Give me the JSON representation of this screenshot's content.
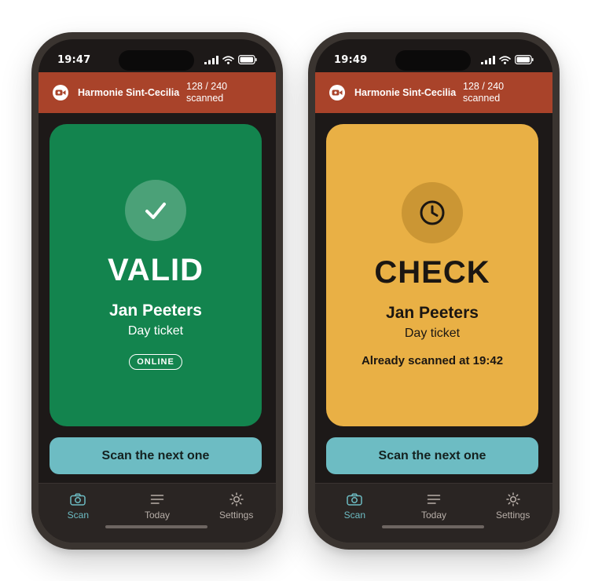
{
  "phones": [
    {
      "status_time": "19:47",
      "header": {
        "org_name": "Harmonie Sint-Cecilia",
        "count": "128 / 240",
        "count_label": "scanned"
      },
      "result": {
        "status": "VALID",
        "icon": "checkmark-icon",
        "color": "#13844e",
        "holder_name": "Jan Peeters",
        "ticket_type": "Day ticket",
        "badge": "ONLINE"
      },
      "next_button": "Scan the next one"
    },
    {
      "status_time": "19:49",
      "header": {
        "org_name": "Harmonie Sint-Cecilia",
        "count": "128 / 240",
        "count_label": "scanned"
      },
      "result": {
        "status": "CHECK",
        "icon": "clock-icon",
        "color": "#e9b045",
        "holder_name": "Jan Peeters",
        "ticket_type": "Day ticket",
        "note": "Already scanned at 19:42"
      },
      "next_button": "Scan the next one"
    }
  ],
  "tabs": [
    {
      "label": "Scan",
      "icon": "camera-icon",
      "active": true
    },
    {
      "label": "Today",
      "icon": "list-icon",
      "active": false
    },
    {
      "label": "Settings",
      "icon": "gear-icon",
      "active": false
    }
  ],
  "colors": {
    "header": "#a9432a",
    "accent": "#6dbcc3",
    "background": "#1d1918"
  }
}
